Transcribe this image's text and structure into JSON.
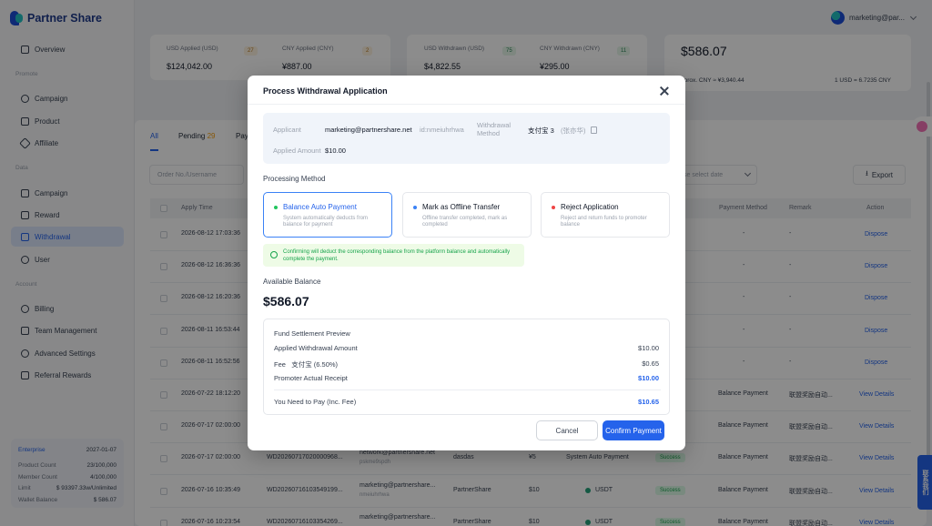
{
  "app": {
    "brand": "Partner Share",
    "user": "marketing@par..."
  },
  "sidebar": {
    "items": [
      {
        "label": "Overview",
        "icon": "monitor-icon"
      },
      {
        "section": "Promote"
      },
      {
        "label": "Campaign",
        "icon": "target-icon"
      },
      {
        "label": "Product",
        "icon": "box-icon"
      },
      {
        "label": "Affiliate",
        "icon": "send-icon"
      },
      {
        "section": "Data"
      },
      {
        "label": "Campaign",
        "icon": "chart-icon"
      },
      {
        "label": "Reward",
        "icon": "gift-icon"
      },
      {
        "label": "Withdrawal",
        "icon": "wallet-icon",
        "active": true
      },
      {
        "label": "User",
        "icon": "user-icon"
      },
      {
        "section": "Account"
      },
      {
        "label": "Billing",
        "icon": "coin-icon"
      },
      {
        "label": "Team Management",
        "icon": "team-icon"
      },
      {
        "label": "Advanced Settings",
        "icon": "gear-icon"
      },
      {
        "label": "Referral Rewards",
        "icon": "share-icon"
      }
    ],
    "plan": {
      "name": "Enterprise",
      "expiry": "2027-01-07",
      "rows": [
        {
          "k": "Product Count",
          "v": "23/100,000"
        },
        {
          "k": "Member Count",
          "v": "4/100,000"
        },
        {
          "k": "Limit",
          "v": "$ 93397.33w/Unlimited"
        },
        {
          "k": "Wallet Balance",
          "v": "$ 586.07"
        }
      ]
    }
  },
  "stats": [
    {
      "label": "USD Applied (USD)",
      "count": "27",
      "value": "$124,042.00"
    },
    {
      "label": "CNY Applied (CNY)",
      "count": "2",
      "value": "¥887.00"
    },
    {
      "label": "USD Withdrawn (USD)",
      "count": "75",
      "value": "$4,822.55"
    },
    {
      "label": "CNY Withdrawn (CNY)",
      "count": "11",
      "value": "¥295.00"
    }
  ],
  "balance_card": {
    "value": "$586.07",
    "approx": "pprox. CNY ≈ ¥3,940.44",
    "rate": "1 USD = 6.7235 CNY"
  },
  "list": {
    "tabs": [
      "All",
      "Pending",
      "Pay"
    ],
    "pending_count": "29",
    "search_placeholder": "Order No./Username",
    "date_placeholder": "se select date",
    "export_label": "Export",
    "headers": [
      "Apply Time",
      "Payment Method",
      "Remark",
      "Action"
    ],
    "rows": [
      {
        "time": "2026-08-12 17:03:36",
        "pm": "-",
        "remark": "-",
        "action": "Dispose"
      },
      {
        "time": "2026-08-12 16:36:36",
        "pm": "-",
        "remark": "-",
        "action": "Dispose"
      },
      {
        "time": "2026-08-12 16:20:36",
        "pm": "-",
        "remark": "-",
        "action": "Dispose"
      },
      {
        "time": "2026-08-11 16:53:44",
        "pm": "-",
        "remark": "-",
        "action": "Dispose"
      },
      {
        "time": "2026-08-11 16:52:56",
        "pm": "-",
        "remark": "-",
        "action": "Dispose"
      },
      {
        "time": "2026-07-22 18:12:20",
        "pm": "Balance Payment",
        "remark": "联盟奖励自动...",
        "action": "View Details"
      },
      {
        "time": "2026-07-17 02:00:00",
        "pm": "Balance Payment",
        "remark": "联盟奖励自动...",
        "action": "View Details"
      },
      {
        "time": "2026-07-17 02:00:00",
        "order": "WD20260717020000968...",
        "user": "network@partnershare.net",
        "user_id": "pskme9spdh",
        "campaign": "dasdas",
        "amount": "¥5",
        "method": "System Auto Payment",
        "status": "Success",
        "pm": "Balance Payment",
        "remark": "联盟奖励自动...",
        "action": "View Details"
      },
      {
        "time": "2026-07-16 10:35:49",
        "order": "WD20260716103549199...",
        "user": "marketing@partnershare...",
        "user_id": "nmeiuhrhwa",
        "campaign": "PartnerShare",
        "amount": "$10",
        "method": "USDT",
        "status": "Success",
        "pm": "Balance Payment",
        "remark": "联盟奖励自动...",
        "action": "View Details"
      },
      {
        "time": "2026-07-16 10:23:54",
        "order": "WD20260716103354269...",
        "user": "marketing@partnershare...",
        "campaign": "PartnerShare",
        "amount": "$10",
        "method": "USDT",
        "status": "Success",
        "pm": "Balance Payment",
        "remark": "联盟奖励自动...",
        "action": "View Details"
      }
    ]
  },
  "modal": {
    "title": "Process Withdrawal Application",
    "applicant_label": "Applicant",
    "applicant_email": "marketing@partnershare.net",
    "applicant_id": "id:nmeiuhrhwa",
    "method_label_1": "Withdrawal",
    "method_label_2": "Method",
    "method_value": "支付宝 3",
    "method_name": "(张亦华)",
    "amount_label": "Applied Amount",
    "amount_value": "$10.00",
    "processing_label": "Processing Method",
    "methods": [
      {
        "title": "Balance Auto Payment",
        "desc": "System automatically deducts from balance for payment",
        "color": "#22c55e"
      },
      {
        "title": "Mark as Offline Transfer",
        "desc": "Offline transfer completed, mark as completed",
        "color": "#3b82f6"
      },
      {
        "title": "Reject Application",
        "desc": "Reject and return funds to promoter balance",
        "color": "#ef4444"
      }
    ],
    "notice": "Confirming will deduct the corresponding balance from the platform balance and automatically complete the payment.",
    "available_label": "Available Balance",
    "available_value": "$586.07",
    "settlement": {
      "title": "Fund Settlement Preview",
      "rows": [
        {
          "k": "Applied Withdrawal Amount",
          "v": "$10.00"
        },
        {
          "k": "Fee",
          "k2": "支付宝 (6.50%)",
          "v": "$0.65"
        },
        {
          "k": "Promoter Actual Receipt",
          "v": "$10.00"
        },
        {
          "k": "You Need to Pay (Inc. Fee)",
          "v": "$10.65"
        }
      ]
    },
    "cancel_label": "Cancel",
    "confirm_label": "Confirm Payment"
  },
  "floating": {
    "contact_label": "联系我们"
  },
  "colors": {
    "primary": "#2563eb",
    "success": "#16a34a",
    "overlay": "rgba(0,0,0,0.45)"
  }
}
